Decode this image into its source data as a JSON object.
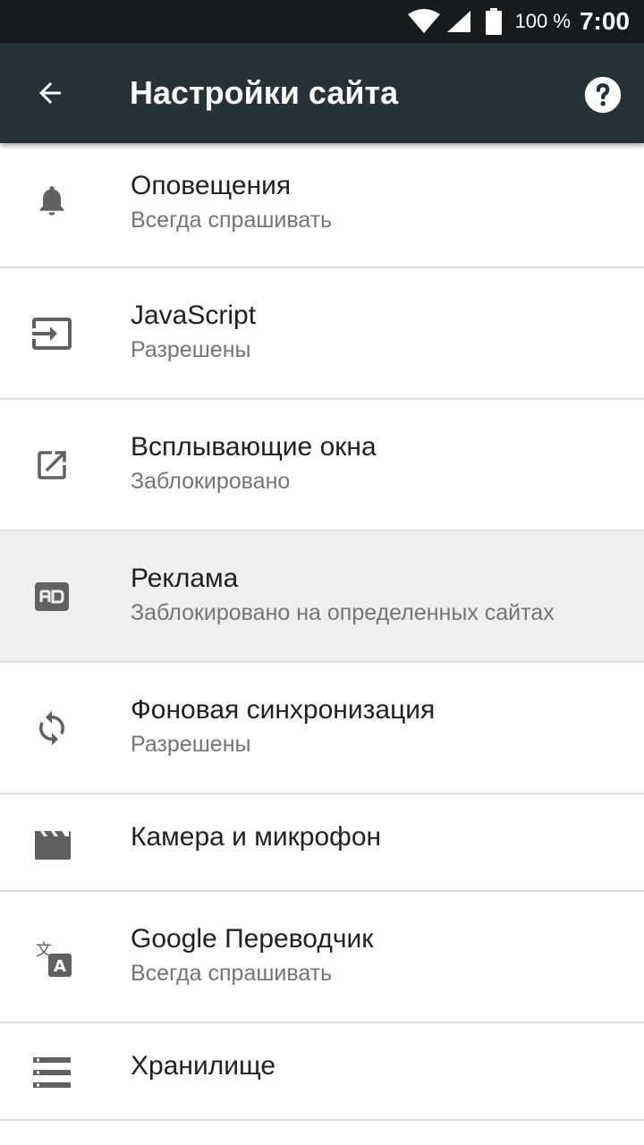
{
  "status_bar": {
    "battery": "100 %",
    "time": "7:00"
  },
  "app_bar": {
    "title": "Настройки сайта",
    "back_icon": "arrow-back-icon",
    "help_icon": "help-circle-icon"
  },
  "items": [
    {
      "icon": "bell-icon",
      "title": "Оповещения",
      "subtitle": "Всегда спрашивать"
    },
    {
      "icon": "input-arrow-icon",
      "title": "JavaScript",
      "subtitle": "Разрешены"
    },
    {
      "icon": "open-in-new-icon",
      "title": "Всплывающие окна",
      "subtitle": "Заблокировано"
    },
    {
      "icon": "ad-icon",
      "title": "Реклама",
      "subtitle": "Заблокировано на определенных сайтах",
      "highlighted": true
    },
    {
      "icon": "sync-icon",
      "title": "Фоновая синхронизация",
      "subtitle": "Разрешены"
    },
    {
      "icon": "camera-clapper-icon",
      "title": "Камера и микрофон"
    },
    {
      "icon": "translate-icon",
      "title": "Google Переводчик",
      "subtitle": "Всегда спрашивать"
    },
    {
      "icon": "storage-icon",
      "title": "Хранилище"
    }
  ],
  "colors": {
    "status_bar": "#161b1f",
    "app_bar": "#263238",
    "icon": "#616161",
    "highlight": "#efefef"
  }
}
